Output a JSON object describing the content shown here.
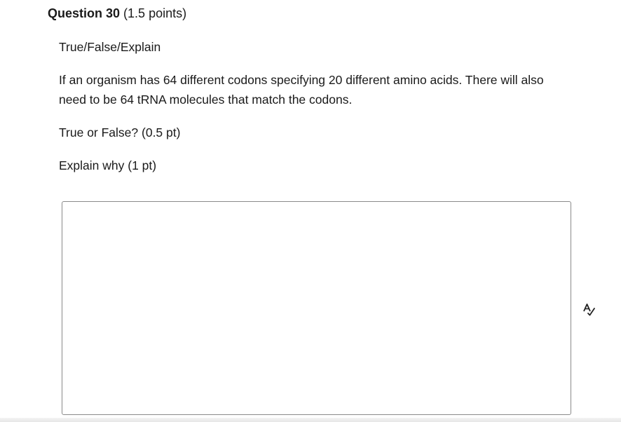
{
  "question": {
    "number_label": "Question 30",
    "points_label": "(1.5 points)",
    "type_label": "True/False/Explain",
    "prompt": "If an organism has 64 different codons specifying 20 different amino acids. There will also need to be 64 tRNA molecules that match the codons.",
    "sub_question_1": "True or False? (0.5 pt)",
    "sub_question_2": "Explain why (1 pt)"
  },
  "answer": {
    "value": "",
    "placeholder": ""
  },
  "icons": {
    "spellcheck": "spellcheck-icon"
  }
}
